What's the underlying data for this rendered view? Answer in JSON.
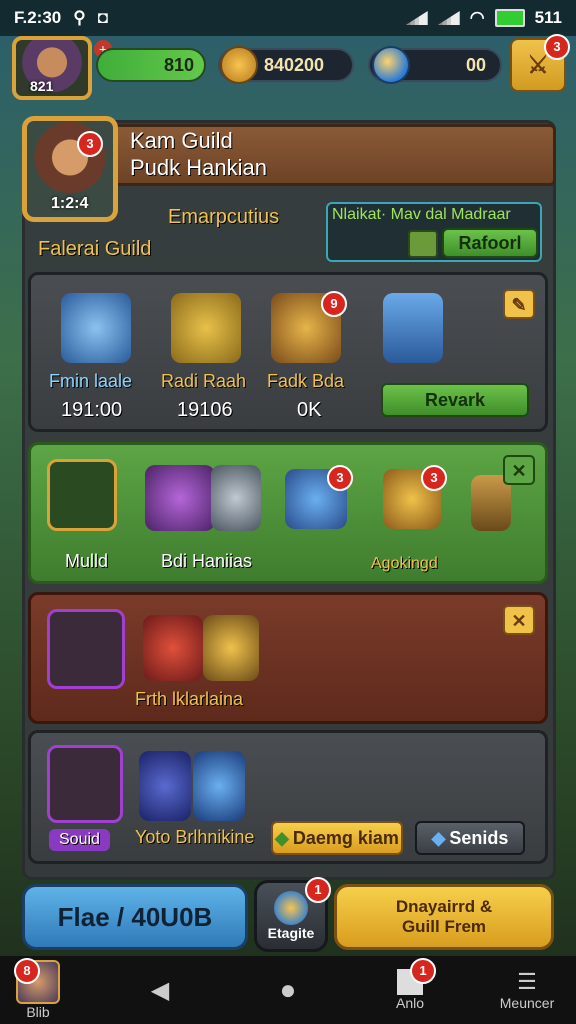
{
  "status_bar": {
    "time": "F.2:30",
    "battery_label": "511"
  },
  "top_bar": {
    "player_level": "821",
    "hp_value": "810",
    "coins": "840200",
    "gems": "00",
    "quest_badge": "3"
  },
  "guild": {
    "title": "Kam Guild",
    "subtitle": "Pudk Hankian",
    "level": "1:2:4",
    "avatar_badge": "3",
    "emblem_label": "Emarpcutius",
    "guild_type": "Falerai Guild",
    "market_label": "Nlaikat· Mav dal Madraar",
    "market_button": "Rafoorl"
  },
  "rows": {
    "row1": {
      "items": [
        {
          "label": "Fmin laale",
          "value": "191:00"
        },
        {
          "label": "Radi Raah",
          "value": "19106"
        },
        {
          "label": "Fadk Bda",
          "value": "0K"
        }
      ],
      "badge": "9",
      "button": "Revark"
    },
    "row2": {
      "label_left": "Mulld",
      "label_mid": "Bdi Haniias",
      "label_right": "Agokingd",
      "badge1": "3",
      "badge2": "3"
    },
    "row3": {
      "label": "Frth lklarlaina"
    },
    "row4": {
      "label_left": "Souid",
      "label_mid": "Yoto Brlhnikine",
      "button1": "Daemg kiam",
      "button2": "Senids"
    }
  },
  "bottom_buttons": {
    "left": "Flae / 40U0B",
    "middle": "Etagite",
    "middle_badge": "1",
    "right_line1": "Dnayairrd &",
    "right_line2": "Guill Frem"
  },
  "nav": {
    "profile_label": "Blib",
    "profile_badge": "8",
    "apps_label": "Anlo",
    "apps_badge": "1",
    "menu_label": "Meuncer"
  }
}
